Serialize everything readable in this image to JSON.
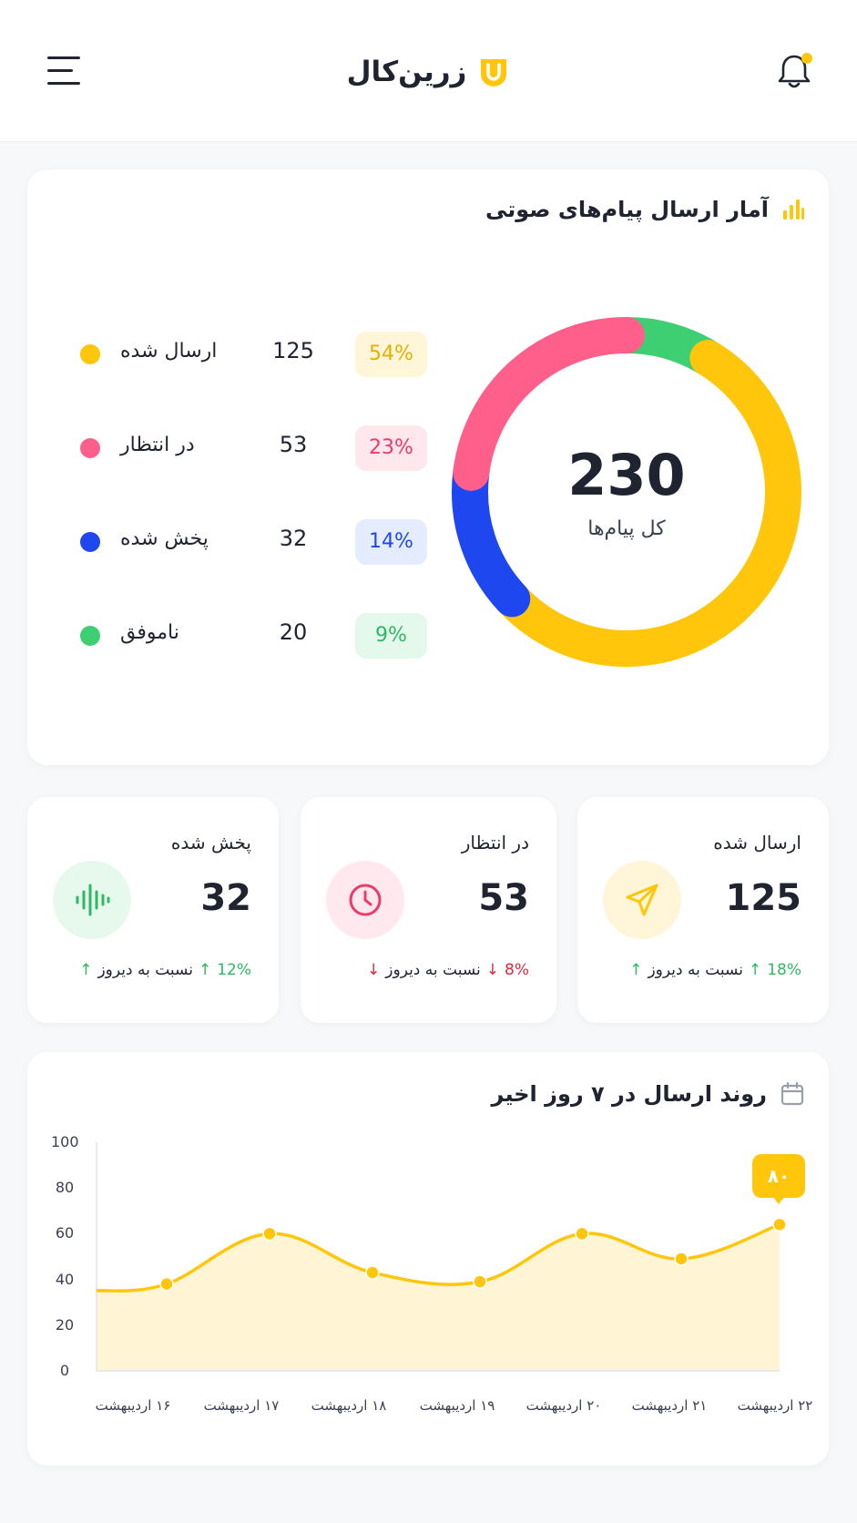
{
  "app": {
    "brand_name": "زرین‌کال",
    "brand_color": "#ffc60b",
    "has_notification": true
  },
  "summary_card": {
    "title": "آمار ارسال پیام‌های صوتی",
    "total_value": "230",
    "total_label": "کل پیام‌ها",
    "items": [
      {
        "label": "ارسال شده",
        "count": "125",
        "percent": "54%",
        "color": "#ffc60b"
      },
      {
        "label": "در انتظار",
        "count": "53",
        "percent": "23%",
        "color": "#ff5f8a"
      },
      {
        "label": "پخش شده",
        "count": "32",
        "percent": "14%",
        "color": "#1f47f0"
      },
      {
        "label": "ناموفق",
        "count": "20",
        "percent": "9%",
        "color": "#3ecf72"
      }
    ]
  },
  "stats": [
    {
      "label": "ارسال شده",
      "value": "125",
      "change": "18%",
      "change_text": "نسبت به دیروز",
      "trend": "up",
      "icon": "paper-plane-icon"
    },
    {
      "label": "در انتظار",
      "value": "53",
      "change": "8%",
      "change_text": "نسبت به دیروز",
      "trend": "down",
      "icon": "clock-icon"
    },
    {
      "label": "پخش شده",
      "value": "32",
      "change": "12%",
      "change_text": "نسبت به دیروز",
      "trend": "up",
      "icon": "sound-wave-icon"
    }
  ],
  "trend_card": {
    "title": "روند ارسال در ۷ روز اخیر",
    "tooltip_value": "۸۰"
  },
  "chart_data": {
    "type": "area",
    "x": [
      "۱۶ اردیبهشت",
      "۱۷ اردیبهشت",
      "۱۸ اردیبهشت",
      "۱۹ اردیبهشت",
      "۲۰ اردیبهشت",
      "۲۱ اردیبهشت",
      "۲۲ اردیبهشت"
    ],
    "series": [
      {
        "values": [
          38,
          60,
          43,
          39,
          60,
          49,
          64
        ]
      }
    ],
    "ylim": [
      0,
      100
    ],
    "yticks": [
      "100",
      "80",
      "60",
      "40",
      "20",
      "0"
    ],
    "line_color": "#ffc60b",
    "fill_color": "#fff3cc",
    "grid": false
  }
}
